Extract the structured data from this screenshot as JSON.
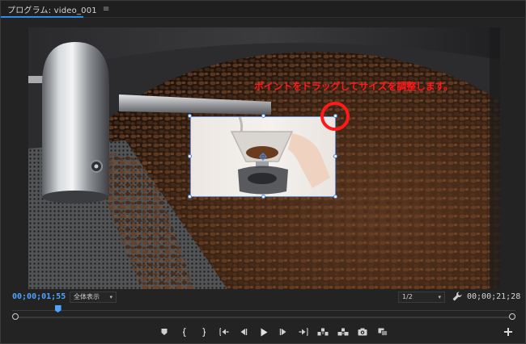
{
  "panel": {
    "title": "プログラム: video_001",
    "menu_icon": "hamburger-menu-icon"
  },
  "viewer": {
    "annotation_text": "ポイントをドラッグしてサイズを調整します。",
    "annotation_color": "#ff1a1a",
    "selection_color": "#4e86d8"
  },
  "controls": {
    "current_timecode": "00;00;01;55",
    "current_timecode_color": "#4ea3ff",
    "fit_select": {
      "value": "全体表示"
    },
    "resolution_select": {
      "value": "1/2"
    },
    "settings_icon": "wrench-icon",
    "total_timecode": "00;00;21;28"
  },
  "timeline": {
    "playhead_fraction": 0.091
  },
  "transport": {
    "buttons": [
      {
        "name": "add-marker-button",
        "icon": "marker-icon"
      },
      {
        "name": "mark-in-button",
        "icon": "mark-in-icon"
      },
      {
        "name": "mark-out-button",
        "icon": "mark-out-icon"
      },
      {
        "name": "go-to-in-button",
        "icon": "go-to-in-icon"
      },
      {
        "name": "step-back-button",
        "icon": "step-back-icon"
      },
      {
        "name": "play-button",
        "icon": "play-icon"
      },
      {
        "name": "step-forward-button",
        "icon": "step-forward-icon"
      },
      {
        "name": "go-to-out-button",
        "icon": "go-to-out-icon"
      },
      {
        "name": "lift-button",
        "icon": "lift-icon"
      },
      {
        "name": "extract-button",
        "icon": "extract-icon"
      },
      {
        "name": "export-frame-button",
        "icon": "camera-icon"
      },
      {
        "name": "comparison-view-button",
        "icon": "comparison-view-icon"
      }
    ],
    "add_button_icon": "plus-icon"
  }
}
